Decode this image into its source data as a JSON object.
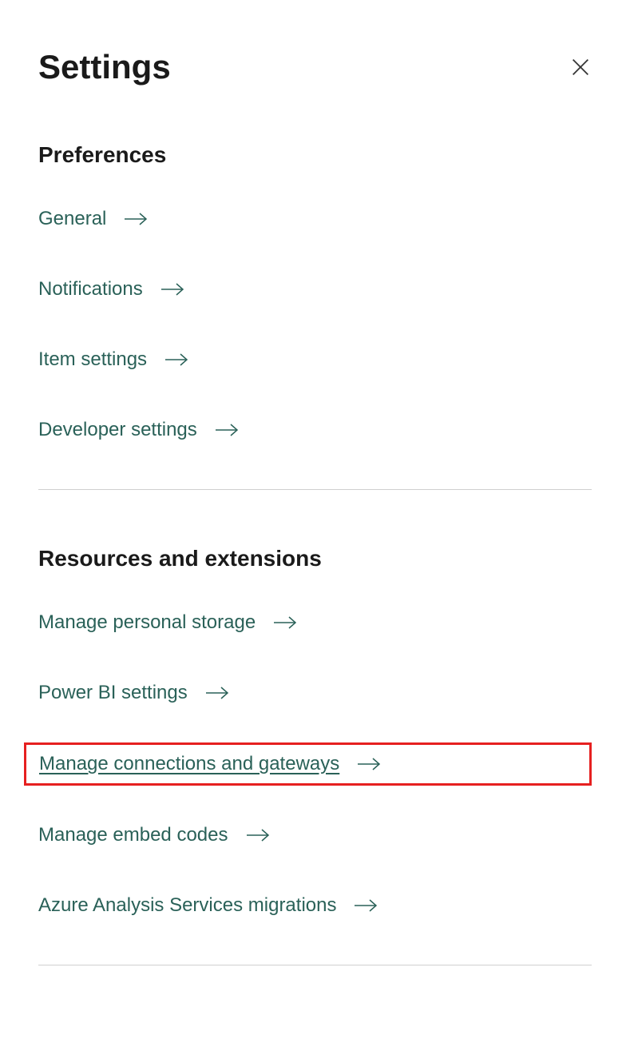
{
  "title": "Settings",
  "sections": [
    {
      "heading": "Preferences",
      "items": [
        {
          "label": "General"
        },
        {
          "label": "Notifications"
        },
        {
          "label": "Item settings"
        },
        {
          "label": "Developer settings"
        }
      ]
    },
    {
      "heading": "Resources and extensions",
      "items": [
        {
          "label": "Manage personal storage"
        },
        {
          "label": "Power BI settings"
        },
        {
          "label": "Manage connections and gateways"
        },
        {
          "label": "Manage embed codes"
        },
        {
          "label": "Azure Analysis Services migrations"
        }
      ]
    }
  ]
}
